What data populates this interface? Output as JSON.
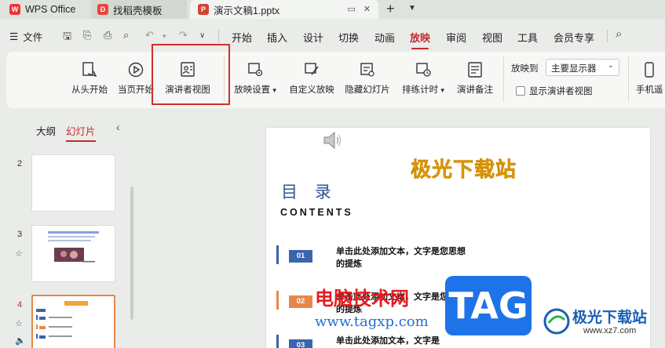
{
  "tabs": {
    "wps": "WPS Office",
    "template": "找稻壳模板",
    "document": "演示文稿1.pptx"
  },
  "menu": {
    "file": "文件",
    "items": [
      "开始",
      "插入",
      "设计",
      "切换",
      "动画",
      "放映",
      "审阅",
      "视图",
      "工具",
      "会员专享"
    ]
  },
  "ribbon": {
    "from_start": "从头开始",
    "from_current": "当页开始",
    "presenter_view": "演讲者视图",
    "show_settings": "放映设置",
    "custom_show": "自定义放映",
    "hide_slide": "隐藏幻灯片",
    "rehearse": "排练计时",
    "speaker_notes": "演讲备注",
    "play_to_label": "放映到",
    "monitor_value": "主要显示器",
    "show_presenter_view": "显示演讲者视图",
    "phone_remote": "手机遥"
  },
  "sidepane": {
    "outline_tab": "大纲",
    "slides_tab": "幻灯片",
    "slide_numbers": [
      "2",
      "3",
      "4"
    ]
  },
  "slide": {
    "brand": "极光下载站",
    "toc_title": "目 录",
    "toc_subtitle": "CONTENTS",
    "items": [
      {
        "num": "01",
        "text": "单击此处添加文本，文字是您思想的提炼",
        "color": "#3a64ad"
      },
      {
        "num": "02",
        "text": "单击此处添加文本，文字是您思想的提炼",
        "color": "#e8874a"
      },
      {
        "num": "03",
        "text": "单击此处添加文本，文字是",
        "color": "#3a64ad"
      }
    ]
  },
  "watermarks": {
    "site_cn": "电脑技术网",
    "site_url": "www.tagxp.com",
    "tag": "TAG",
    "logo_text": "极光下载站",
    "logo_url": "www.xz7.com"
  },
  "colors": {
    "accent": "#c4282f",
    "highlight": "#d42c2c",
    "toc_blue": "#3a64ad",
    "toc_orange": "#e8874a",
    "brand_yellow": "#f2b90d"
  }
}
